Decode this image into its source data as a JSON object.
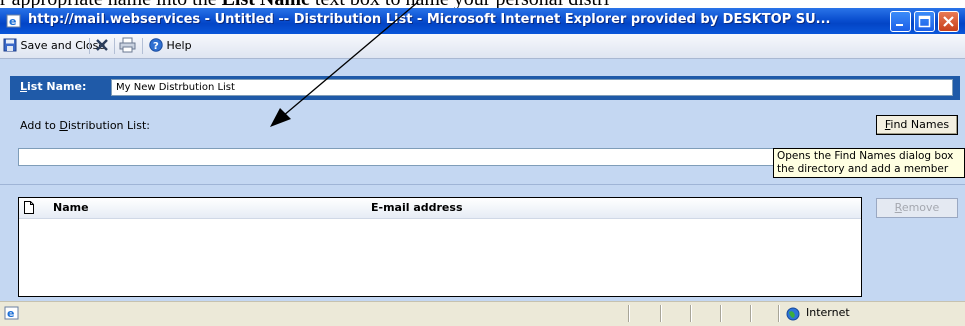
{
  "document": {
    "caption_prefix": "r appropriate name into the ",
    "caption_bold": "List Name",
    "caption_suffix": " text box to name your personal distri"
  },
  "window": {
    "title": "http://mail.webservices - Untitled -- Distribution List - Microsoft Internet Explorer provided by DESKTOP SU..."
  },
  "toolbar": {
    "save_close_label": "Save and Close",
    "help_label": "Help"
  },
  "form": {
    "list_name_label": "List Name:",
    "list_name_value": "My New Distrbution List",
    "add_label_prefix": "Add to ",
    "add_label_underline": "D",
    "add_label_suffix": "istribution List:",
    "find_names_underline": "F",
    "find_names_rest": "ind Names",
    "add_input_value": "",
    "tooltip_line1": "Opens the Find Names dialog box",
    "tooltip_line2": "the directory and add a member",
    "members_columns": {
      "name": "Name",
      "email": "E-mail address"
    },
    "remove_underline": "R",
    "remove_rest": "emove"
  },
  "statusbar": {
    "zone_label": "Internet"
  },
  "colors": {
    "titlebar": "#0a4fd0",
    "form_bg": "#c4d7f2",
    "list_name_bar": "#1f5aa8"
  }
}
